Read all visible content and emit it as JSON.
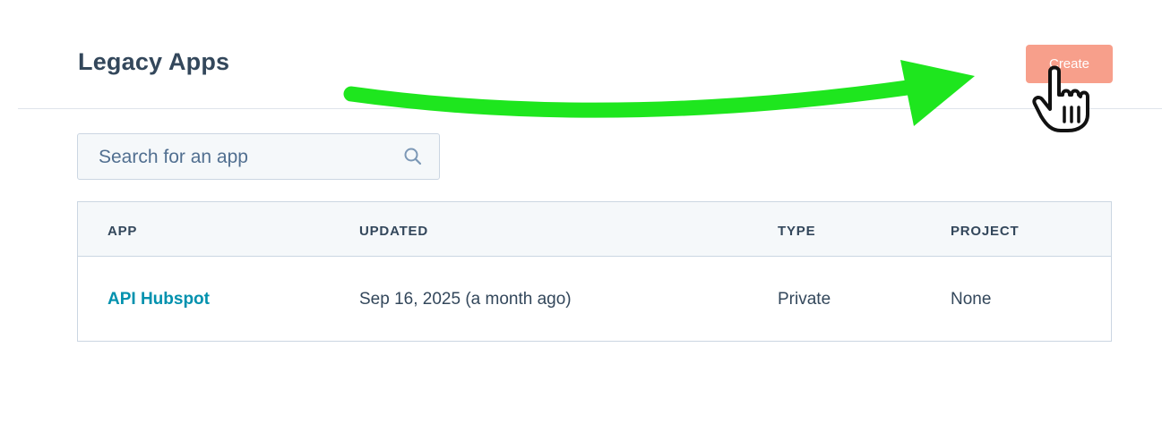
{
  "header": {
    "title": "Legacy Apps",
    "create_label": "Create"
  },
  "search": {
    "placeholder": "Search for an app"
  },
  "table": {
    "columns": [
      "APP",
      "UPDATED",
      "TYPE",
      "PROJECT"
    ],
    "rows": [
      {
        "app": "API Hubspot",
        "updated": "Sep 16, 2025 (a month ago)",
        "type": "Private",
        "project": "None"
      }
    ]
  },
  "colors": {
    "accent_create": "#f79a85",
    "link": "#0091ae",
    "annotation_arrow": "#1ee61e",
    "text": "#33475b"
  },
  "icons": {
    "search": "search-icon",
    "cursor": "hand-pointer-icon",
    "annotation": "arrow-icon"
  }
}
